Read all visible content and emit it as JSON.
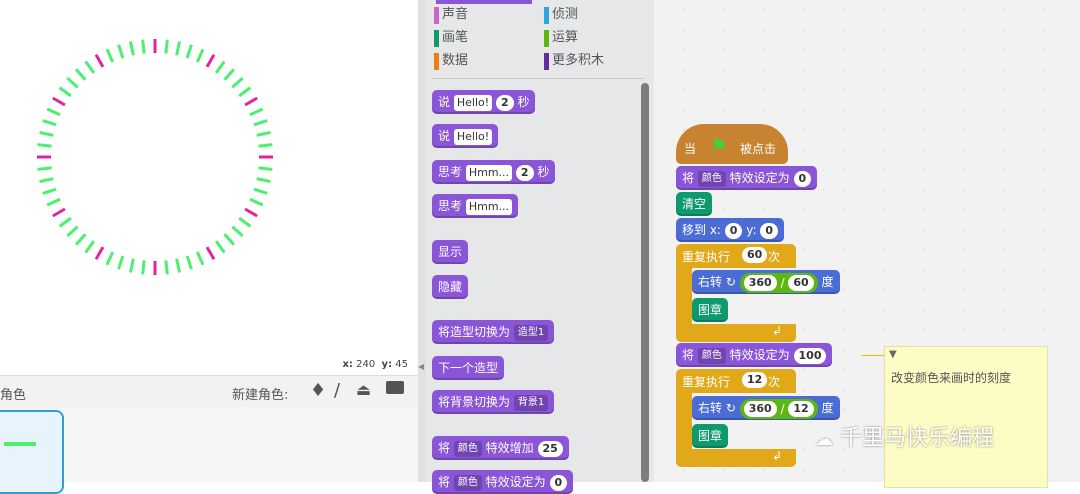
{
  "stage": {
    "coords": {
      "x_label": "x:",
      "x_value": "240",
      "y_label": "y:",
      "y_value": "45"
    }
  },
  "sprites": {
    "header_label": "角色",
    "new_sprite_label": "新建角色:"
  },
  "palette": {
    "categories": [
      {
        "label": "声音",
        "color": "#cf63cf"
      },
      {
        "label": "侦测",
        "color": "#2ca5e2"
      },
      {
        "label": "画笔",
        "color": "#0e9a6c"
      },
      {
        "label": "运算",
        "color": "#5cb712"
      },
      {
        "label": "数据",
        "color": "#ee7d16"
      },
      {
        "label": "更多积木",
        "color": "#632d99"
      }
    ],
    "blocks": {
      "say_secs": {
        "text": "说",
        "msg": "Hello!",
        "secs": "2",
        "unit": "秒"
      },
      "say": {
        "text": "说",
        "msg": "Hello!"
      },
      "think_secs": {
        "text": "思考",
        "msg": "Hmm...",
        "secs": "2",
        "unit": "秒"
      },
      "think": {
        "text": "思考",
        "msg": "Hmm..."
      },
      "show": "显示",
      "hide": "隐藏",
      "switch_costume": {
        "text": "将造型切换为",
        "value": "造型1"
      },
      "next_costume": "下一个造型",
      "switch_backdrop": {
        "text": "将背景切换为",
        "value": "背景1"
      },
      "change_effect": {
        "text": "将",
        "effect": "颜色",
        "mid": "特效增加",
        "value": "25"
      },
      "set_effect": {
        "text": "将",
        "effect": "颜色",
        "mid": "特效设定为",
        "value": "0"
      }
    }
  },
  "script": {
    "hat": {
      "when": "当",
      "clicked": "被点击"
    },
    "set_effect_1": {
      "text": "将",
      "effect": "颜色",
      "mid": "特效设定为",
      "value": "0"
    },
    "clear": "清空",
    "goto": {
      "text": "移到 x:",
      "x": "0",
      "y_label": "y:",
      "y": "0"
    },
    "repeat_1": {
      "text": "重复执行",
      "count": "60",
      "unit": "次"
    },
    "turn_1": {
      "text": "右转",
      "a": "360",
      "op": "/",
      "b": "60",
      "unit": "度"
    },
    "stamp_1": "图章",
    "set_effect_2": {
      "text": "将",
      "effect": "颜色",
      "mid": "特效设定为",
      "value": "100"
    },
    "repeat_2": {
      "text": "重复执行",
      "count": "12",
      "unit": "次"
    },
    "turn_2": {
      "text": "右转",
      "a": "360",
      "op": "/",
      "b": "12",
      "unit": "度"
    },
    "stamp_2": "图章"
  },
  "note": {
    "text": "改变颜色来画时的刻度"
  },
  "watermark": "千里马快乐编程",
  "colors": {
    "tick_green": "#4cf070",
    "tick_magenta": "#e0259e"
  }
}
